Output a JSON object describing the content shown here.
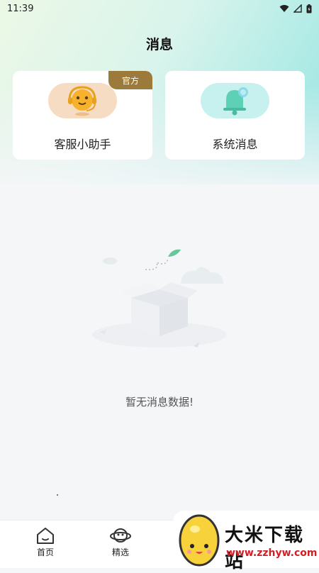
{
  "status_bar": {
    "time": "11:39"
  },
  "header": {
    "title": "消息"
  },
  "cards": [
    {
      "label": "客服小助手",
      "badge": "官方",
      "icon": "customer-service-icon"
    },
    {
      "label": "系统消息",
      "icon": "bell-icon"
    }
  ],
  "empty_state": {
    "text": "暂无消息数据!",
    "icon": "empty-box-illustration"
  },
  "tab_bar": {
    "items": [
      {
        "label": "首页",
        "icon": "home-icon"
      },
      {
        "label": "精选",
        "icon": "planet-icon"
      }
    ]
  },
  "watermark": {
    "title": "大米下载站",
    "url": "www.zzhyw.com"
  },
  "colors": {
    "badge": "#9b7a3b",
    "header_gradient_start": "#ecf8e6",
    "header_gradient_end": "#9fe6e6",
    "watermark_url": "#d21f26"
  }
}
